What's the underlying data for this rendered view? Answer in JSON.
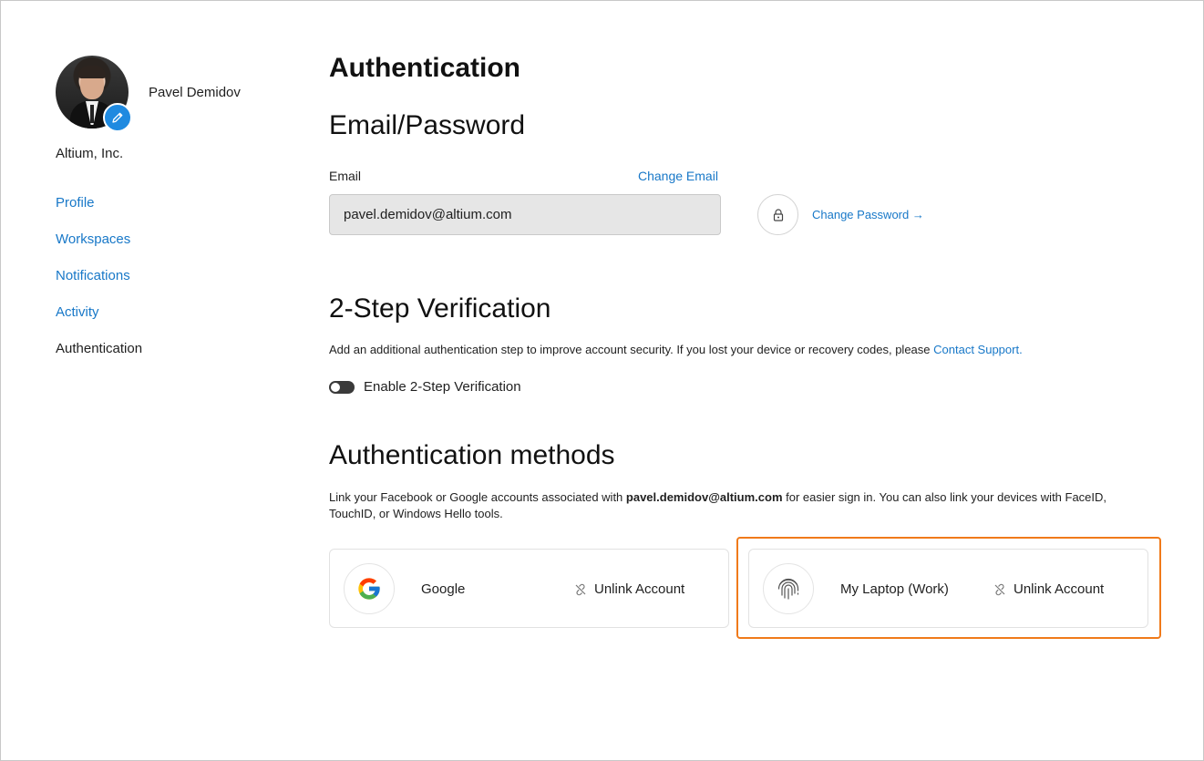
{
  "sidebar": {
    "user_name": "Pavel Demidov",
    "organization": "Altium, Inc.",
    "items": [
      {
        "label": "Profile",
        "active": false
      },
      {
        "label": "Workspaces",
        "active": false
      },
      {
        "label": "Notifications",
        "active": false
      },
      {
        "label": "Activity",
        "active": false
      },
      {
        "label": "Authentication",
        "active": true
      }
    ]
  },
  "main": {
    "page_title": "Authentication",
    "email_password": {
      "heading": "Email/Password",
      "email_label": "Email",
      "change_email": "Change Email",
      "email_value": "pavel.demidov@altium.com",
      "change_password": "Change Password →"
    },
    "two_step": {
      "heading": "2-Step Verification",
      "description": "Add an additional authentication step to improve account security. If you lost your device or recovery codes, please ",
      "contact_link": "Contact Support.",
      "toggle_label": "Enable 2-Step Verification",
      "enabled": false
    },
    "auth_methods": {
      "heading": "Authentication methods",
      "desc_prefix": "Link your Facebook or Google accounts associated with ",
      "desc_email": "pavel.demidov@altium.com",
      "desc_suffix": " for easier sign in. You can also link your devices with FaceID, TouchID, or Windows Hello tools.",
      "cards": [
        {
          "title": "Google",
          "icon": "google-icon",
          "action": "Unlink Account"
        },
        {
          "title": "My Laptop (Work)",
          "icon": "fingerprint-icon",
          "action": "Unlink Account"
        }
      ]
    }
  },
  "colors": {
    "link": "#1878c8",
    "edit_badge": "#1f8ae0",
    "highlight": "#f07a1a",
    "toggle_off": "#3a3a3a"
  }
}
